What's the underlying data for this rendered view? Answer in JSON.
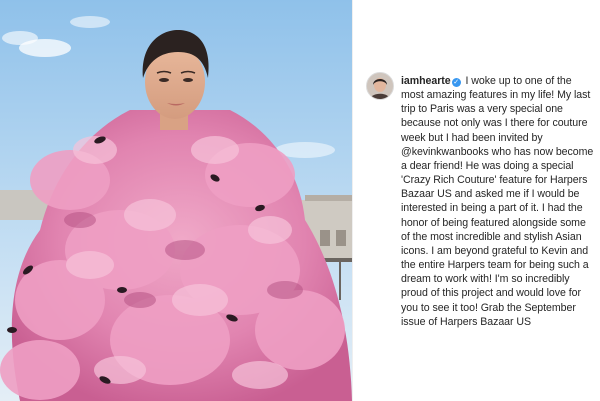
{
  "post": {
    "username": "iamhearte",
    "verified_icon": "verified-badge-icon",
    "caption_lead": "I woke up to one of the most amazing features in my life! My last trip to Paris was a very special one because not only was I there for couture week but I had been invited by",
    "mention": "@kevinkwanbooks",
    "caption_tail": "who has now become a dear friend! He was doing a special 'Crazy Rich Couture' feature for Harpers Bazaar US and asked me if I would be interested in being a part of it. I had the honor of being featured alongside some of the most incredible and stylish Asian icons. I am beyond grateful to Kevin and the entire Harpers team for being such a dream to work with! I'm so incredibly proud of this project and would love for you to see it too! Grab the September issue of Harpers Bazaar US"
  },
  "colors": {
    "verified": "#3897f0",
    "text": "#262626",
    "sky": "#a9cde9",
    "feathers": "#e58fb7"
  }
}
